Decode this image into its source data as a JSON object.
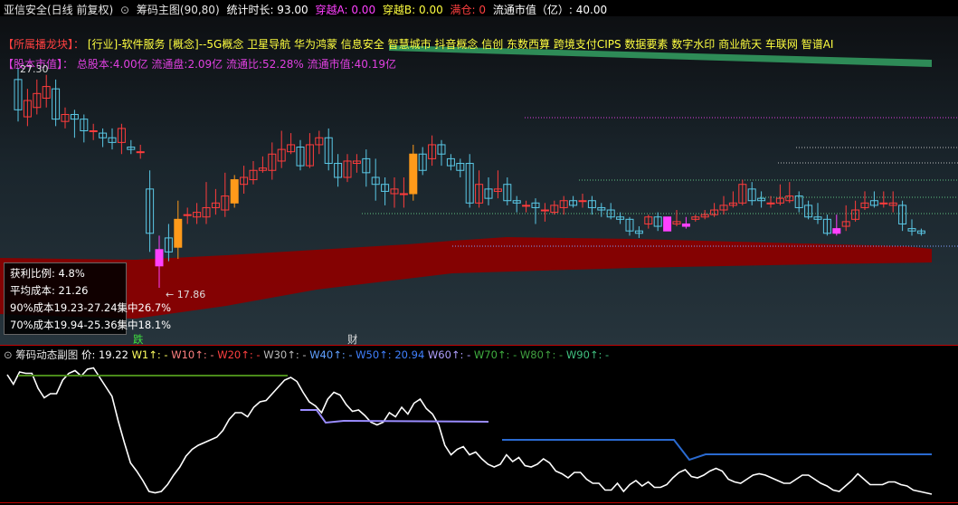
{
  "header": {
    "stock_title": "亚信安全(日线 前复权)",
    "main_indicator": "筹码主图(90,80)",
    "stat_label": "统计时长: 93.00",
    "cross_a": "穿越A: 0.00",
    "cross_b": "穿越B: 0.00",
    "full_pos": "满仓: 0",
    "float_cap": "流通市值（亿）: 40.00"
  },
  "concept": {
    "label": "【所属播龙块】：",
    "industry": "[行业]-软件服务",
    "concepts": "[概念]--5G概念 卫星导航 华为鸿蒙 信息安全 智慧城市 抖音概念 信创 东数西算 跨境支付CIPS 数据要素 数字水印 商业航天 车联网 智谱AI"
  },
  "capital": {
    "label": "【股本市值】：",
    "text": "总股本:4.00亿 流通盘:2.09亿 流通比:52.28% 流通市值:40.19亿"
  },
  "price_marks": {
    "high": "27.30",
    "low": "← 17.86"
  },
  "chip_stats": {
    "profit_ratio": "获利比例: 4.8%",
    "avg_cost": "平均成本: 21.26",
    "cost_90": "90%成本19.23-27.24集中26.7%",
    "cost_70": "70%成本19.94-25.36集中18.1%"
  },
  "badges": {
    "fall": "跌",
    "fin": "财"
  },
  "sub_header": {
    "title": "筹码动态副图",
    "price": "价: 19.22",
    "w1": "W1↑: -",
    "w10": "W10↑: -",
    "w20": "W20↑: -",
    "w30": "W30↑: -",
    "w40": "W40↑: -",
    "w50": "W50↑: 20.94",
    "w60": "W60↑: -",
    "w70": "W70↑: -",
    "w80": "W80↑: -",
    "w90": "W90↑: -"
  },
  "colors": {
    "up": "#ff3c3c",
    "down": "#5ac8e6",
    "yang_fill": "#ff9a1a",
    "magenta": "#ff40ff",
    "yellow": "#ffff40",
    "purple_text": "#e040e0",
    "band": "#8a0000",
    "green_line": "#2e8b57"
  },
  "chart_data": {
    "type": "candlestick",
    "candles": [
      [
        26.8,
        25.5,
        27.3,
        25.0,
        0
      ],
      [
        25.2,
        25.9,
        26.4,
        24.8,
        0
      ],
      [
        25.6,
        26.2,
        26.8,
        25.3,
        1
      ],
      [
        26.0,
        26.5,
        27.0,
        25.6,
        0
      ],
      [
        26.4,
        25.1,
        26.8,
        24.8,
        0
      ],
      [
        25.0,
        25.3,
        25.6,
        24.7,
        1
      ],
      [
        25.3,
        25.1,
        25.5,
        24.3,
        0
      ],
      [
        25.1,
        24.6,
        25.3,
        24.1,
        0
      ],
      [
        24.6,
        24.6,
        24.9,
        24.2,
        1
      ],
      [
        24.5,
        24.3,
        24.7,
        23.9,
        0
      ],
      [
        24.3,
        24.1,
        24.7,
        23.8,
        0
      ],
      [
        24.1,
        24.7,
        24.9,
        23.6,
        1
      ],
      [
        23.9,
        23.8,
        24.2,
        23.6,
        0
      ],
      [
        23.7,
        23.7,
        24.0,
        23.4,
        1
      ],
      [
        22.1,
        20.2,
        22.9,
        19.4,
        0
      ],
      [
        19.5,
        18.8,
        20.1,
        17.86,
        2
      ],
      [
        20.0,
        19.4,
        20.6,
        19.0,
        0
      ],
      [
        19.6,
        20.8,
        21.6,
        19.1,
        3
      ],
      [
        21.0,
        21.0,
        21.3,
        20.6,
        1
      ],
      [
        20.9,
        21.1,
        21.5,
        20.6,
        1
      ],
      [
        20.9,
        21.3,
        22.4,
        20.6,
        1
      ],
      [
        21.3,
        21.5,
        22.1,
        21.0,
        1
      ],
      [
        21.2,
        21.8,
        22.8,
        20.9,
        1
      ],
      [
        21.5,
        22.5,
        22.7,
        21.3,
        3
      ],
      [
        22.3,
        22.6,
        23.1,
        21.9,
        1
      ],
      [
        22.5,
        22.9,
        23.3,
        22.3,
        1
      ],
      [
        22.9,
        23.0,
        23.5,
        22.8,
        1
      ],
      [
        22.9,
        23.6,
        24.1,
        22.5,
        1
      ],
      [
        23.3,
        23.8,
        24.6,
        23.0,
        1
      ],
      [
        23.7,
        24.0,
        24.5,
        23.6,
        1
      ],
      [
        23.9,
        23.1,
        24.2,
        22.9,
        0
      ],
      [
        23.1,
        24.0,
        24.5,
        23.0,
        1
      ],
      [
        24.0,
        24.3,
        24.6,
        23.6,
        1
      ],
      [
        24.3,
        23.2,
        24.7,
        22.9,
        0
      ],
      [
        23.2,
        22.6,
        23.6,
        22.2,
        0
      ],
      [
        22.6,
        23.3,
        23.6,
        22.4,
        1
      ],
      [
        23.2,
        23.3,
        23.6,
        22.8,
        1
      ],
      [
        23.4,
        22.8,
        23.8,
        22.2,
        0
      ],
      [
        22.6,
        22.3,
        23.4,
        21.6,
        0
      ],
      [
        22.3,
        22.0,
        22.6,
        21.4,
        0
      ],
      [
        21.9,
        22.1,
        22.6,
        21.3,
        1
      ],
      [
        21.9,
        21.9,
        22.6,
        21.3,
        1
      ],
      [
        21.9,
        23.6,
        24.0,
        21.6,
        3
      ],
      [
        23.6,
        22.9,
        23.9,
        22.7,
        0
      ],
      [
        23.4,
        24.0,
        24.4,
        23.1,
        1
      ],
      [
        24.0,
        23.6,
        24.2,
        23.1,
        0
      ],
      [
        23.4,
        23.1,
        23.6,
        22.9,
        0
      ],
      [
        23.2,
        22.9,
        23.4,
        22.6,
        0
      ],
      [
        23.2,
        21.5,
        23.6,
        21.3,
        0
      ],
      [
        21.5,
        22.3,
        22.9,
        21.3,
        1
      ],
      [
        22.1,
        21.7,
        22.6,
        21.4,
        0
      ],
      [
        22.0,
        22.1,
        22.9,
        21.7,
        1
      ],
      [
        22.3,
        21.6,
        22.6,
        21.4,
        0
      ],
      [
        21.6,
        21.5,
        21.8,
        21.1,
        0
      ],
      [
        21.4,
        21.4,
        21.6,
        21.1,
        1
      ],
      [
        21.5,
        21.3,
        21.7,
        20.6,
        0
      ],
      [
        21.2,
        21.2,
        21.5,
        20.7,
        1
      ],
      [
        21.1,
        21.4,
        21.6,
        21.0,
        1
      ],
      [
        21.3,
        21.6,
        21.8,
        21.0,
        1
      ],
      [
        21.6,
        21.4,
        21.8,
        21.3,
        0
      ],
      [
        21.6,
        21.6,
        21.9,
        21.3,
        1
      ],
      [
        21.6,
        21.3,
        21.8,
        21.0,
        0
      ],
      [
        21.3,
        21.2,
        21.5,
        20.9,
        0
      ],
      [
        21.2,
        20.9,
        21.5,
        20.8,
        0
      ],
      [
        20.9,
        20.8,
        21.1,
        20.6,
        0
      ],
      [
        20.8,
        20.3,
        20.9,
        20.1,
        0
      ],
      [
        20.3,
        20.2,
        20.5,
        20.0,
        0
      ],
      [
        20.6,
        20.9,
        21.0,
        20.4,
        1
      ],
      [
        20.9,
        20.5,
        21.1,
        20.3,
        0
      ],
      [
        20.3,
        20.9,
        20.9,
        20.3,
        2
      ],
      [
        20.6,
        20.7,
        21.2,
        20.5,
        1
      ],
      [
        20.5,
        20.6,
        20.9,
        20.4,
        2
      ],
      [
        20.8,
        20.9,
        21.0,
        20.7,
        1
      ],
      [
        20.9,
        21.0,
        21.2,
        20.8,
        1
      ],
      [
        21.0,
        21.2,
        21.5,
        20.9,
        1
      ],
      [
        21.2,
        21.4,
        21.8,
        21.0,
        1
      ],
      [
        21.4,
        21.5,
        22.0,
        21.3,
        1
      ],
      [
        21.5,
        22.3,
        22.5,
        21.4,
        1
      ],
      [
        22.1,
        21.6,
        22.4,
        21.4,
        0
      ],
      [
        21.7,
        21.6,
        22.0,
        21.3,
        0
      ],
      [
        21.5,
        21.5,
        21.8,
        21.3,
        1
      ],
      [
        21.5,
        21.7,
        22.3,
        21.4,
        1
      ],
      [
        21.6,
        21.8,
        22.4,
        21.5,
        1
      ],
      [
        21.8,
        21.3,
        22.0,
        21.1,
        0
      ],
      [
        21.4,
        20.9,
        21.6,
        20.8,
        0
      ],
      [
        20.9,
        20.8,
        21.5,
        20.6,
        0
      ],
      [
        20.8,
        20.2,
        21.0,
        20.1,
        0
      ],
      [
        20.2,
        20.4,
        21.0,
        20.1,
        2
      ],
      [
        20.5,
        20.7,
        21.4,
        20.3,
        1
      ],
      [
        20.8,
        21.2,
        21.6,
        20.7,
        1
      ],
      [
        21.3,
        21.5,
        22.0,
        21.2,
        1
      ],
      [
        21.6,
        21.4,
        22.0,
        21.3,
        0
      ],
      [
        21.5,
        21.5,
        22.0,
        21.3,
        1
      ],
      [
        21.4,
        21.5,
        22.0,
        21.1,
        1
      ],
      [
        21.4,
        20.6,
        21.6,
        20.3,
        0
      ],
      [
        20.4,
        20.3,
        20.8,
        20.1,
        0
      ],
      [
        20.3,
        20.2,
        20.4,
        20.1,
        0
      ]
    ],
    "price_line": [
      92,
      85,
      94,
      93,
      93,
      82,
      75,
      78,
      78,
      88,
      93,
      95,
      91,
      96,
      97,
      90,
      83,
      76,
      58,
      42,
      27,
      21,
      14,
      6,
      5,
      6,
      11,
      18,
      24,
      32,
      37,
      40,
      42,
      44,
      46,
      51,
      59,
      64,
      64,
      61,
      68,
      72,
      73,
      78,
      83,
      88,
      90,
      87,
      79,
      72,
      69,
      64,
      74,
      79,
      77,
      70,
      65,
      66,
      62,
      57,
      55,
      57,
      64,
      61,
      68,
      63,
      71,
      74,
      67,
      63,
      55,
      40,
      33,
      37,
      39,
      33,
      35,
      30,
      26,
      24,
      26,
      33,
      28,
      31,
      25,
      24,
      26,
      30,
      27,
      21,
      19,
      16,
      20,
      20,
      15,
      12,
      12,
      7,
      7,
      12,
      6,
      11,
      14,
      10,
      13,
      9,
      9,
      11,
      16,
      20,
      22,
      17,
      16,
      18,
      21,
      23,
      21,
      15,
      13,
      12,
      15,
      18,
      19,
      18,
      16,
      14,
      12,
      12,
      15,
      18,
      18,
      15,
      12,
      10,
      7,
      6,
      10,
      14,
      19,
      15,
      11,
      11,
      11,
      13,
      13,
      11,
      10,
      7,
      6,
      5,
      4
    ],
    "price_range": [
      17.5,
      27.6
    ]
  }
}
